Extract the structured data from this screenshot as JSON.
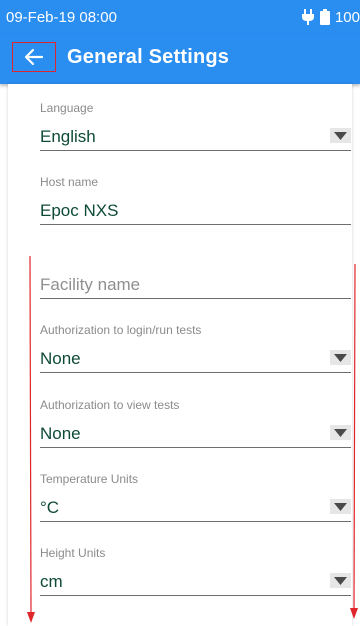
{
  "status_bar": {
    "datetime": "09-Feb-19 08:00",
    "battery": "100"
  },
  "app_bar": {
    "title": "General Settings"
  },
  "settings": {
    "language": {
      "label": "Language",
      "value": "English"
    },
    "host_name": {
      "label": "Host name",
      "value": "Epoc NXS"
    },
    "facility_name": {
      "placeholder": "Facility name"
    },
    "auth_login": {
      "label": "Authorization to login/run tests",
      "value": "None"
    },
    "auth_view": {
      "label": "Authorization to view tests",
      "value": "None"
    },
    "temperature_units": {
      "label": "Temperature Units",
      "value": "°C"
    },
    "height_units": {
      "label": "Height Units",
      "value": "cm"
    }
  },
  "colors": {
    "primary": "#2a8df0",
    "value_text": "#0e4a38",
    "annotation_red": "#e0262b"
  },
  "icons": [
    "back-arrow-icon",
    "charging-plug-icon",
    "battery-icon",
    "dropdown-arrow-icon",
    "scroll-arrow-icon"
  ]
}
